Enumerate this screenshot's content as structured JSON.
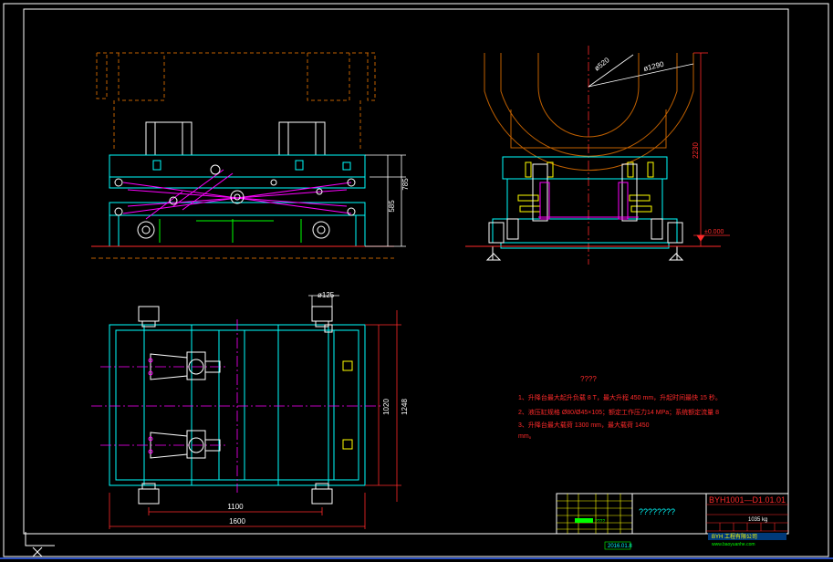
{
  "drawing": {
    "colors": {
      "background": "#000000",
      "frame": "#ffffff",
      "cyan": "#00ffff",
      "magenta": "#ff00ff",
      "yellow": "#ffff00",
      "orange": "#c06000",
      "red": "#ff2a2a",
      "green": "#00ff00",
      "blue": "#3a6bff"
    },
    "front_view": {
      "dim_height_inner": "585",
      "dim_height_outer": "785"
    },
    "side_view": {
      "dia_inner": "ø520",
      "dia_outer": "ø1290",
      "dim_height": "2230",
      "elevation": "±0.000"
    },
    "plan_view": {
      "dia_wheel": "ø125",
      "dim_width_inner": "1100",
      "dim_width_outer": "1600",
      "dim_depth_inner": "1020",
      "dim_depth_outer": "1248"
    },
    "notes": {
      "heading": "????",
      "line1": "1、升降台最大起升负载 8 T，最大升程 450 mm，升起时间最快 15 秒。",
      "line2": "2、液压缸规格 Ø80/Ø45×105；额定工作压力14 MPa；系统额定流量 8",
      "line3": "3、升降台最大载荷 1300 mm，最大载荷 1450",
      "line4": "mm。"
    },
    "title_block": {
      "drawing_number": "BYH1001—D1.01.01",
      "name_placeholder": "????????",
      "weight": "1035 kg",
      "green_label": "????",
      "company": "BYH 工程有限公司",
      "website": "www.baoyuanhe.com",
      "date": "2016.01.8"
    }
  }
}
